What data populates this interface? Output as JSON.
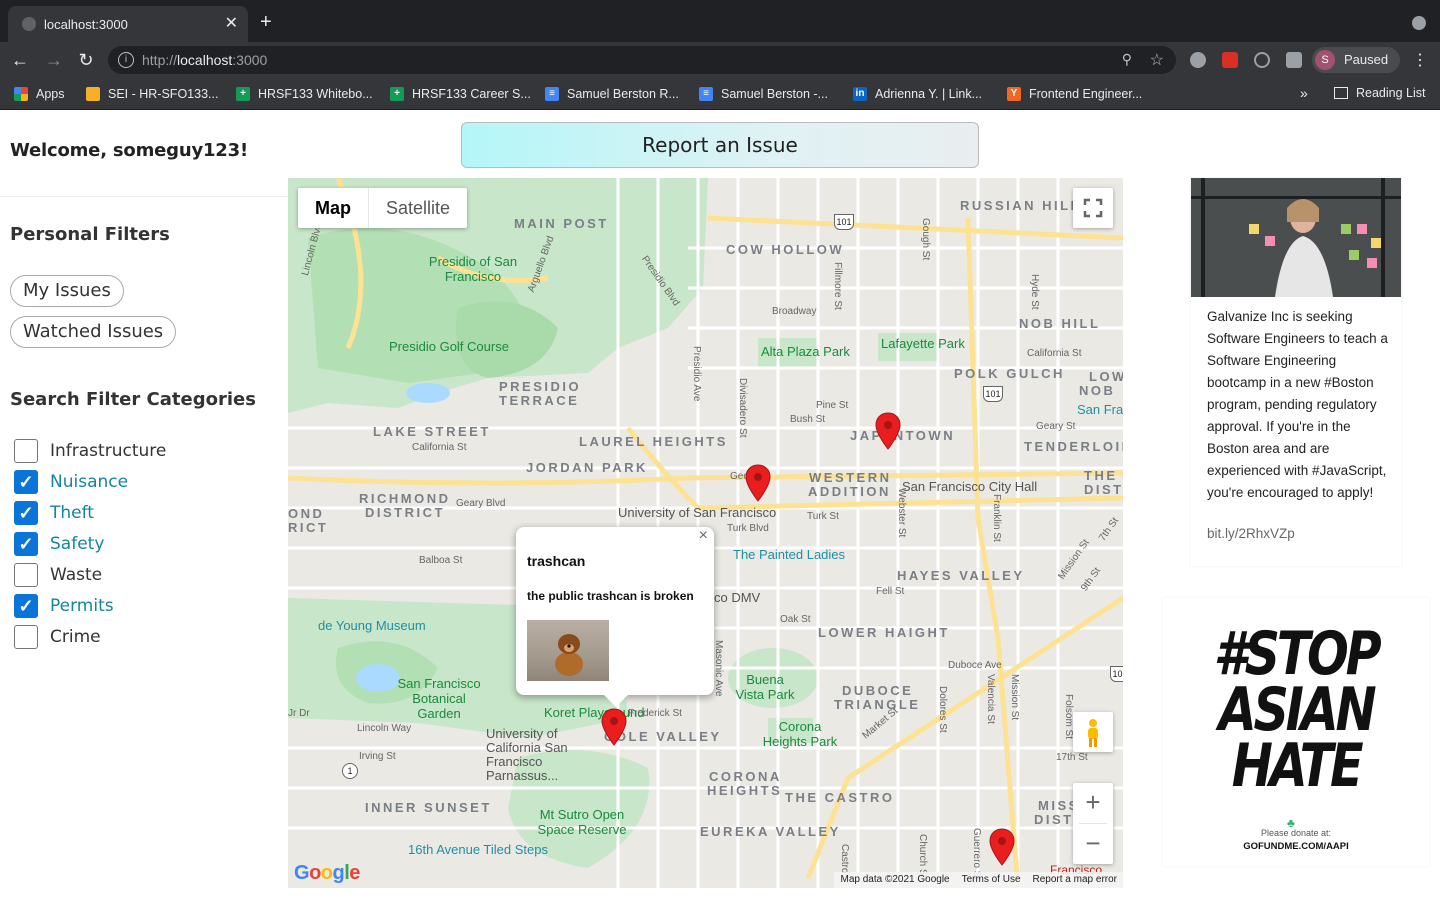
{
  "browser": {
    "tab_title": "localhost:3000",
    "url_prefix": "http://",
    "url_host": "localhost",
    "url_port": ":3000",
    "profile_initial": "S",
    "profile_status": "Paused",
    "bookmarks": [
      {
        "label": "Apps",
        "icon_color": "#e8453c"
      },
      {
        "label": "SEI - HR-SFO133...",
        "icon_color": "#f6b026"
      },
      {
        "label": "HRSF133 Whitebo...",
        "icon_color": "#0f9d58"
      },
      {
        "label": "HRSF133 Career S...",
        "icon_color": "#0f9d58"
      },
      {
        "label": "Samuel Berston R...",
        "icon_color": "#4285f4"
      },
      {
        "label": "Samuel Berston -...",
        "icon_color": "#4285f4"
      },
      {
        "label": "Adrienna Y. | Link...",
        "icon_color": "#0a66c2"
      },
      {
        "label": "Frontend Engineer...",
        "icon_color": "#f26522"
      }
    ],
    "bookmarks_more": "»",
    "reading_list": "Reading List"
  },
  "page": {
    "welcome": "Welcome, someguy123!",
    "report_button": "Report an Issue",
    "personal_filters_heading": "Personal Filters",
    "my_issues": "My Issues",
    "watched_issues": "Watched Issues",
    "search_categories_heading": "Search Filter Categories",
    "categories": [
      {
        "label": "Infrastructure",
        "checked": false
      },
      {
        "label": "Nuisance",
        "checked": true
      },
      {
        "label": "Theft",
        "checked": true
      },
      {
        "label": "Safety",
        "checked": true
      },
      {
        "label": "Waste",
        "checked": false
      },
      {
        "label": "Permits",
        "checked": true
      },
      {
        "label": "Crime",
        "checked": false
      }
    ]
  },
  "map": {
    "type_map": "Map",
    "type_satellite": "Satellite",
    "zoom_in": "+",
    "zoom_out": "−",
    "logo": "Google",
    "attribution": {
      "data": "Map data ©2021 Google",
      "terms": "Terms of Use",
      "error": "Report a map error"
    },
    "neighborhoods": [
      "MAIN POST",
      "COW HOLLOW",
      "RUSSIAN HILL",
      "NOB HILL",
      "POLK GULCH",
      "PRESIDIO",
      "TERRACE",
      "LAKE STREET",
      "LAUREL HEIGHTS",
      "JORDAN PARK",
      "JAPANTOWN",
      "TENDERLOIN",
      "WESTERN",
      "ADDITION",
      "RICHMOND",
      "DISTRICT",
      "HAYES VALLEY",
      "LOWER HAIGHT",
      "DUBOCE",
      "TRIANGLE",
      "COLE VALLEY",
      "CORONA",
      "HEIGHTS",
      "THE CASTRO",
      "INNER SUNSET",
      "EUREKA VALLEY",
      "THE",
      "DIST",
      "LOW",
      "NOB",
      "MISS",
      "DIST",
      "OND",
      "RICT"
    ],
    "parks": [
      "Presidio of San Francisco",
      "Presidio Golf Course",
      "Alta Plaza Park",
      "Lafayette Park",
      "Buena Vista Park",
      "Corona Heights Park",
      "Mt Sutro Open Space Reserve",
      "San Francisco Botanical Garden",
      "Koret Playground"
    ],
    "pois": [
      "de Young Museum",
      "The Painted Ladies",
      "San Francisco City Hall",
      "co DMV",
      "16th Avenue Tiled Steps",
      "University of California San Francisco Parnassus...",
      "University of San Francisco",
      "San Fra",
      "Francisco"
    ],
    "streets": [
      "Broadway",
      "California St",
      "Pine St",
      "Bush St",
      "Geary St",
      "Turk St",
      "Turk Blvd",
      "Fell St",
      "Oak St",
      "Balboa St",
      "Geary Blvd",
      "Lincoln Way",
      "Irving St",
      "Frederick St",
      "Duboce Ave",
      "Market St",
      "17th St",
      "Divisadero St",
      "Webster St",
      "Franklin St",
      "Gough St",
      "Hyde St",
      "Fillmore St",
      "Masonic Ave",
      "Presidio Ave",
      "Dolores St",
      "Valencia St",
      "Mission St",
      "Guerrero St",
      "Church St",
      "Folsom St",
      "Castro",
      "Lincoln Blvd",
      "Arguello Blvd",
      "Presidio Blvd",
      "Jr Dr",
      "Geo",
      "Mission St",
      "9th St",
      "7th St",
      "California St"
    ],
    "route_shields": [
      "101",
      "101",
      "101",
      "1",
      "101"
    ],
    "marker_color": "#ea1e1e",
    "info_window": {
      "title": "trashcan",
      "description": "the public trashcan is broken",
      "close": "×"
    }
  },
  "ads": {
    "galvanize_text": "Galvanize Inc is seeking Software Engineers to teach a Software Engineering bootcamp in a new #Boston program, pending regulatory approval. If you're in the Boston area and are experienced with #JavaScript, you're encouraged to apply!",
    "galvanize_link": "bit.ly/2RhxVZp",
    "stop_line1": "#STOP",
    "stop_line2": "ASIAN",
    "stop_line3": "HATE",
    "donate": "Please donate at:",
    "gofundme": "GOFUNDME.COM/AAPI"
  }
}
